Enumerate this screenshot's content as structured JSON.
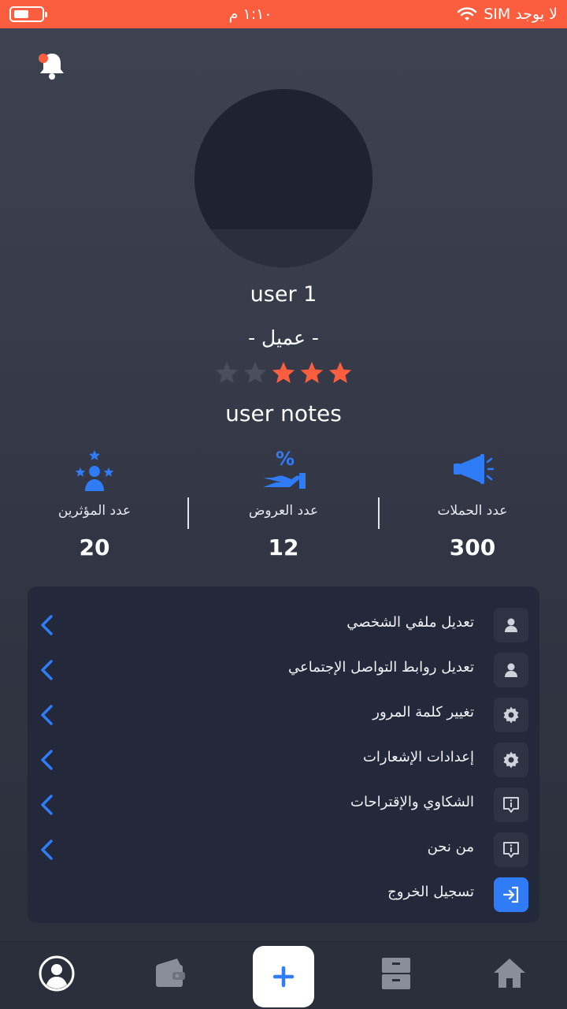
{
  "status_bar": {
    "carrier": "لا يوجد SIM",
    "time": "١:١٠ م",
    "bg_color": "#fb5d3f"
  },
  "profile": {
    "username": "user 1",
    "role": "-  عميل  -",
    "rating": 3,
    "rating_max": 5,
    "notes": "user notes"
  },
  "stats": [
    {
      "label": "عدد الحملات",
      "value": "300",
      "icon": "megaphone-icon"
    },
    {
      "label": "عدد العروض",
      "value": "12",
      "icon": "discount-hand-icon"
    },
    {
      "label": "عدد المؤثرين",
      "value": "20",
      "icon": "influencers-icon"
    }
  ],
  "menu": {
    "items": [
      {
        "label": "تعديل ملفي الشخصي",
        "icon": "person-icon"
      },
      {
        "label": "تعديل روابط التواصل الإجتماعي",
        "icon": "person-icon"
      },
      {
        "label": "تغيير كلمة المرور",
        "icon": "gear-icon"
      },
      {
        "label": "إعدادات الإشعارات",
        "icon": "gear-icon"
      },
      {
        "label": "الشكاوي والإقتراحات",
        "icon": "info-bubble-icon"
      },
      {
        "label": "من نحن",
        "icon": "info-bubble-icon"
      },
      {
        "label": "تسجيل الخروج",
        "icon": "logout-icon"
      }
    ]
  },
  "tabbar": {
    "items": [
      "profile-tab",
      "wallet-tab",
      "add-tab",
      "archive-tab",
      "home-tab"
    ],
    "accent": "#2f7cf6"
  },
  "colors": {
    "accent_blue": "#2f7cf6",
    "star_active": "#fb5d3f",
    "star_inactive": "#4a4f5e"
  }
}
